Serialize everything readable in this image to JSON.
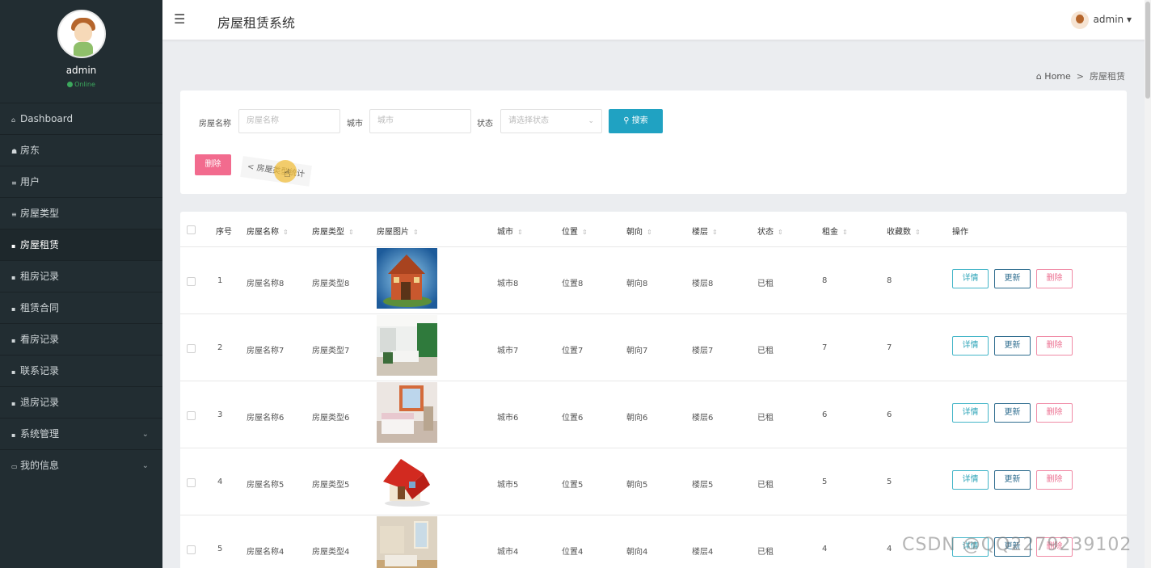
{
  "sidebar": {
    "user_name": "admin",
    "status": "Online",
    "items": [
      {
        "icon": "home-icon",
        "glyph": "⌂",
        "label": "Dashboard"
      },
      {
        "icon": "user-icon",
        "glyph": "☗",
        "label": "房东"
      },
      {
        "icon": "list-icon",
        "glyph": "≡",
        "label": "用户"
      },
      {
        "icon": "list-icon",
        "glyph": "≡",
        "label": "房屋类型"
      },
      {
        "icon": "grid-icon",
        "glyph": "▪",
        "label": "房屋租赁"
      },
      {
        "icon": "lock-icon",
        "glyph": "▪",
        "label": "租房记录"
      },
      {
        "icon": "grid-icon",
        "glyph": "▪",
        "label": "租赁合同"
      },
      {
        "icon": "calendar-icon",
        "glyph": "▪",
        "label": "看房记录"
      },
      {
        "icon": "book-icon",
        "glyph": "▪",
        "label": "联系记录"
      },
      {
        "icon": "table-icon",
        "glyph": "▪",
        "label": "退房记录"
      },
      {
        "icon": "grid-icon",
        "glyph": "▪",
        "label": "系统管理"
      },
      {
        "icon": "card-icon",
        "glyph": "▭",
        "label": "我的信息"
      }
    ],
    "active_index": 4
  },
  "header": {
    "title": "房屋租赁系统",
    "user_name": "admin",
    "hamburger_glyph": "☰",
    "dropdown_glyph": "▾"
  },
  "breadcrumb": {
    "home": "Home",
    "separator": ">",
    "current": "房屋租赁"
  },
  "search": {
    "name_label": "房屋名称",
    "name_placeholder": "房屋名称",
    "city_label": "城市",
    "city_placeholder": "城市",
    "status_label": "状态",
    "status_placeholder": "请选择状态",
    "search_button": "搜索",
    "delete_button": "删除",
    "stats_button": "房屋类型统计"
  },
  "table": {
    "headers": [
      "序号",
      "房屋名称",
      "房屋类型",
      "房屋图片",
      "城市",
      "位置",
      "朝向",
      "楼层",
      "状态",
      "租金",
      "收藏数",
      "操作"
    ],
    "rows": [
      {
        "no": "1",
        "name": "房屋名称8",
        "type": "房屋类型8",
        "city": "城市8",
        "location": "位置8",
        "orientation": "朝向8",
        "floor": "楼层8",
        "status": "已租",
        "rent": "8",
        "favorites": "8"
      },
      {
        "no": "2",
        "name": "房屋名称7",
        "type": "房屋类型7",
        "city": "城市7",
        "location": "位置7",
        "orientation": "朝向7",
        "floor": "楼层7",
        "status": "已租",
        "rent": "7",
        "favorites": "7"
      },
      {
        "no": "3",
        "name": "房屋名称6",
        "type": "房屋类型6",
        "city": "城市6",
        "location": "位置6",
        "orientation": "朝向6",
        "floor": "楼层6",
        "status": "已租",
        "rent": "6",
        "favorites": "6"
      },
      {
        "no": "4",
        "name": "房屋名称5",
        "type": "房屋类型5",
        "city": "城市5",
        "location": "位置5",
        "orientation": "朝向5",
        "floor": "楼层5",
        "status": "已租",
        "rent": "5",
        "favorites": "5"
      },
      {
        "no": "5",
        "name": "房屋名称4",
        "type": "房屋类型4",
        "city": "城市4",
        "location": "位置4",
        "orientation": "朝向4",
        "floor": "楼层4",
        "status": "已租",
        "rent": "4",
        "favorites": "4"
      }
    ],
    "actions": {
      "detail": "详情",
      "update": "更新",
      "delete": "删除"
    }
  },
  "watermark": "CSDN @QQ2279239102",
  "colors": {
    "sidebar_bg": "#222d32",
    "search_button": "#20a2c2",
    "delete_button": "#f26b8e",
    "online": "#3ca85d"
  }
}
